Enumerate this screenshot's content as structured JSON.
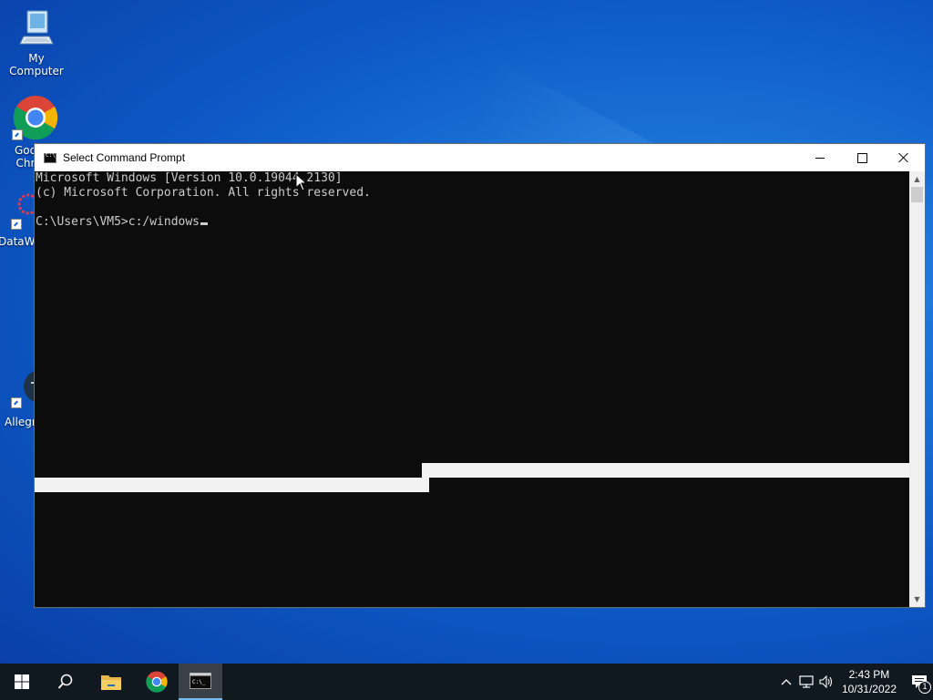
{
  "desktop": {
    "icons": [
      {
        "label": "My Computer"
      },
      {
        "label": "Goo\nChr"
      },
      {
        "label": "DataW"
      },
      {
        "label": "Allegr"
      }
    ]
  },
  "cmd_window": {
    "title": "Select Command Prompt",
    "console_lines": [
      "Microsoft Windows [Version 10.0.19044.2130]",
      "(c) Microsoft Corporation. All rights reserved.",
      "",
      "C:\\Users\\VM5>c:/windows"
    ]
  },
  "taskbar": {
    "items": [
      "start-button",
      "search-icon",
      "file-explorer-icon",
      "chrome-icon",
      "command-prompt-icon"
    ],
    "clock": {
      "time": "2:43 PM",
      "date": "10/31/2022"
    },
    "notification_count": "1"
  },
  "colors": {
    "console_bg": "#0c0c0c",
    "console_text": "#cccccc",
    "taskbar_bg": "#101820",
    "selection": "#f2f2f2"
  }
}
